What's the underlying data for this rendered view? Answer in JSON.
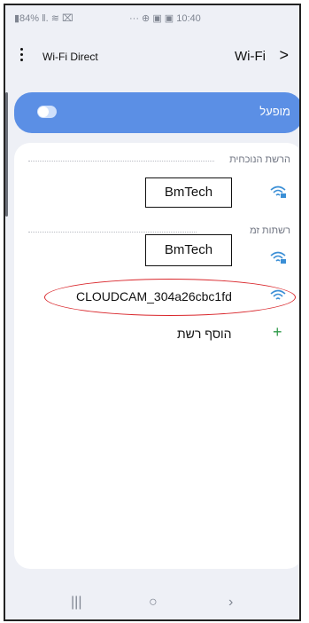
{
  "status_bar": {
    "left_text": "▮84% ǁ. ≋ ⌧",
    "right_text": "··· ⊕ ▣ ▣ 10:40"
  },
  "header": {
    "wifi_direct_label": "Wi-Fi Direct",
    "wifi_label": "Wi-Fi",
    "chevron": ">"
  },
  "toggle": {
    "label": "מופעל",
    "state": "on"
  },
  "current_network": {
    "section_title": "הרשת הנוכחית",
    "name": "BmTech"
  },
  "available_networks": {
    "section_title": "רשתות זמ",
    "items": [
      {
        "name": "BmTech",
        "secured": true
      },
      {
        "name": "CLOUDCAM_304a26cbc1fd",
        "secured": false
      }
    ]
  },
  "add_network": {
    "label": "הוסף רשת",
    "icon": "+"
  },
  "nav": {
    "recents": "|||",
    "home": "○",
    "back": "›"
  },
  "colors": {
    "accent": "#5b8fe5",
    "wifi_icon": "#3b8fd6",
    "highlight": "#d9262b",
    "add_icon": "#2f9a4a"
  }
}
